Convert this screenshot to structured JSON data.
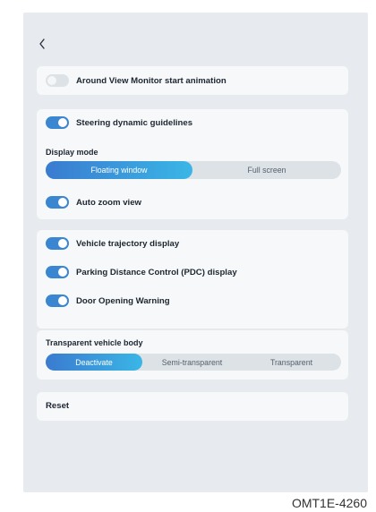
{
  "navigation": {
    "back_icon": "chevron-left-icon"
  },
  "around_view": {
    "start_animation": {
      "label": "Around View Monitor start animation",
      "enabled": false
    }
  },
  "guidelines": {
    "steering_dynamic": {
      "label": "Steering dynamic guidelines",
      "enabled": true
    },
    "display_mode": {
      "title": "Display mode",
      "options": [
        "Floating window",
        "Full screen"
      ],
      "selected": "Floating window"
    },
    "auto_zoom": {
      "label": "Auto zoom view",
      "enabled": true
    }
  },
  "assist": {
    "vehicle_trajectory": {
      "label": "Vehicle trajectory display",
      "enabled": true
    },
    "pdc": {
      "label": "Parking Distance Control (PDC) display",
      "enabled": true
    },
    "door_opening": {
      "label": "Door Opening Warning",
      "enabled": true
    }
  },
  "transparent_body": {
    "title": "Transparent vehicle body",
    "options": [
      "Deactivate",
      "Semi-transparent",
      "Transparent"
    ],
    "selected": "Deactivate"
  },
  "reset": {
    "label": "Reset"
  },
  "figure_code": "OMT1E-4260",
  "colors": {
    "accent": "#3a86d0",
    "screen_bg": "#e7ebef",
    "card_bg": "#f7f8fa",
    "toggle_off": "#dde2e7"
  }
}
